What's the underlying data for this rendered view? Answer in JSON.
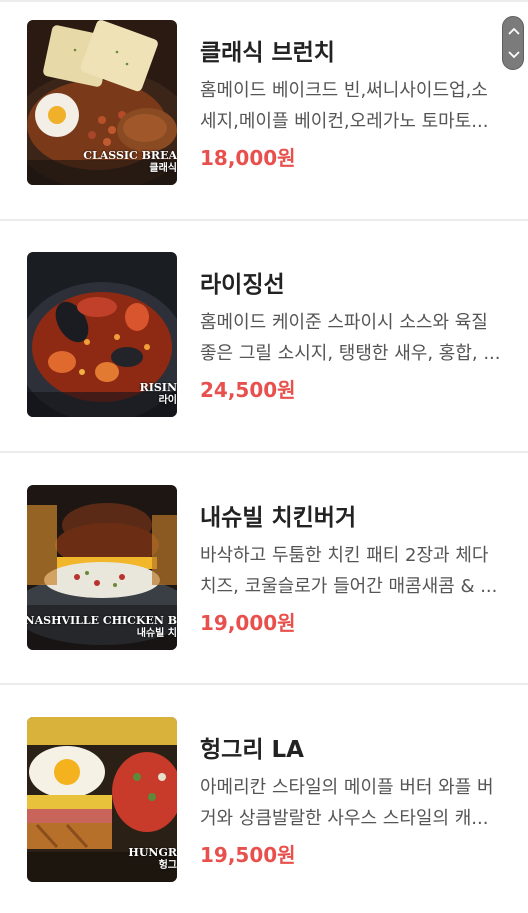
{
  "menu": {
    "items": [
      {
        "name": "클래식 브런치",
        "desc_line1": "홈메이드 베이크드 빈,써니사이드업,소",
        "desc_line2": "세지,메이플 베이컨,오레가노 토마토...",
        "price": "18,000원",
        "caption_en": "CLASSIC BREA",
        "caption_ko": "클래식",
        "image_icon": "brunch-plate-image"
      },
      {
        "name": "라이징선",
        "desc_line1": "홈메이드 케이준 스파이시 소스와 육질",
        "desc_line2": "좋은 그릴 소시지, 탱탱한 새우, 홍합, ...",
        "price": "24,500원",
        "caption_en": "RISIN",
        "caption_ko": "라이",
        "image_icon": "seafood-boil-image"
      },
      {
        "name": "내슈빌 치킨버거",
        "desc_line1": "바삭하고 두툼한 치킨 패티 2장과 체다",
        "desc_line2": "치즈, 코울슬로가 들어간 매콤새콤 & ...",
        "price": "19,000원",
        "caption_en": "NASHVILLE CHICKEN B",
        "caption_ko": "내슈빌 치",
        "image_icon": "chicken-burger-image"
      },
      {
        "name": "헝그리 LA",
        "desc_line1": "아메리칸 스타일의 메이플 버터 와플 버",
        "desc_line2": "거와 상큼발랄한 사우스 스타일의 캐...",
        "price": "19,500원",
        "caption_en": "HUNGR",
        "caption_ko": "헝그",
        "image_icon": "waffle-burger-image"
      }
    ]
  },
  "scroll": {
    "up_icon": "chevron-up-icon",
    "down_icon": "chevron-down-icon"
  },
  "colors": {
    "price": "#e8504e",
    "title": "#222222",
    "description": "#555555",
    "divider": "#ececec"
  }
}
